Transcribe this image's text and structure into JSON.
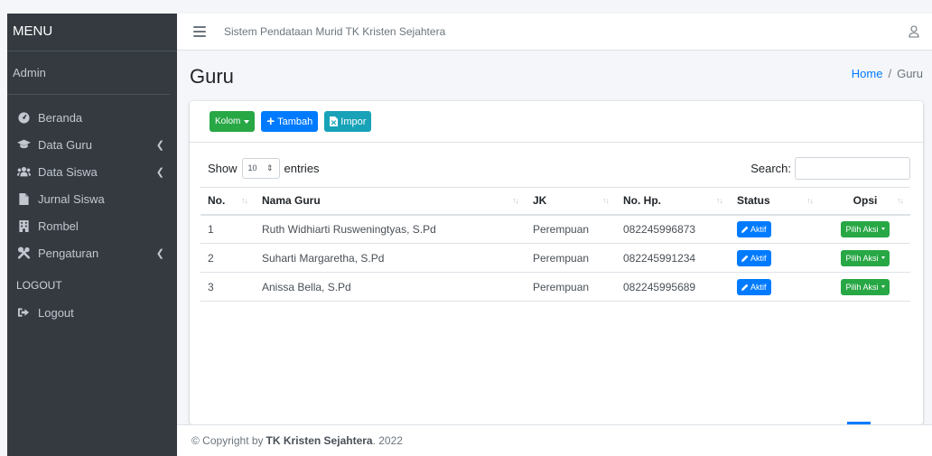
{
  "sidebar": {
    "brand": "MENU",
    "user": "Admin",
    "items": [
      {
        "label": "Beranda",
        "icon": "dashboard-icon"
      },
      {
        "label": "Data Guru",
        "icon": "graduation-cap-icon"
      },
      {
        "label": "Data Siswa",
        "icon": "users-icon"
      },
      {
        "label": "Jurnal Siswa",
        "icon": "file-icon"
      },
      {
        "label": "Rombel",
        "icon": "building-icon"
      },
      {
        "label": "Pengaturan",
        "icon": "tools-icon"
      }
    ],
    "section_logout": "LOGOUT",
    "logout_label": "Logout"
  },
  "navbar": {
    "title": "Sistem Pendataan Murid TK Kristen Sejahtera"
  },
  "page": {
    "title": "Guru",
    "breadcrumb_home": "Home",
    "breadcrumb_sep": "/",
    "breadcrumb_current": "Guru"
  },
  "toolbar": {
    "kolom_label": "Kolom",
    "tambah_label": "Tambah",
    "impor_label": "Impor"
  },
  "datatable": {
    "show_label": "Show",
    "entries_value": "10",
    "entries_label": "entries",
    "search_label": "Search:",
    "columns": [
      "No.",
      "Nama Guru",
      "JK",
      "No. Hp.",
      "Status",
      "Opsi"
    ],
    "rows": [
      {
        "no": "1",
        "nama": "Ruth Widhiarti Rusweningtyas, S.Pd",
        "jk": "Perempuan",
        "hp": "082245996873",
        "status": "Aktif",
        "opsi": "Pilih Aksi"
      },
      {
        "no": "2",
        "nama": "Suharti Margaretha, S.Pd",
        "jk": "Perempuan",
        "hp": "082245991234",
        "status": "Aktif",
        "opsi": "Pilih Aksi"
      },
      {
        "no": "3",
        "nama": "Anissa Bella, S.Pd",
        "jk": "Perempuan",
        "hp": "082245995689",
        "status": "Aktif",
        "opsi": "Pilih Aksi"
      }
    ]
  },
  "footer": {
    "prefix": "© Copyright by",
    "company": "TK Kristen Sejahtera",
    "suffix": ". 2022"
  },
  "colors": {
    "sidebar_bg": "#343a40",
    "primary": "#007bff",
    "success": "#28a745",
    "info": "#17a2b8"
  }
}
